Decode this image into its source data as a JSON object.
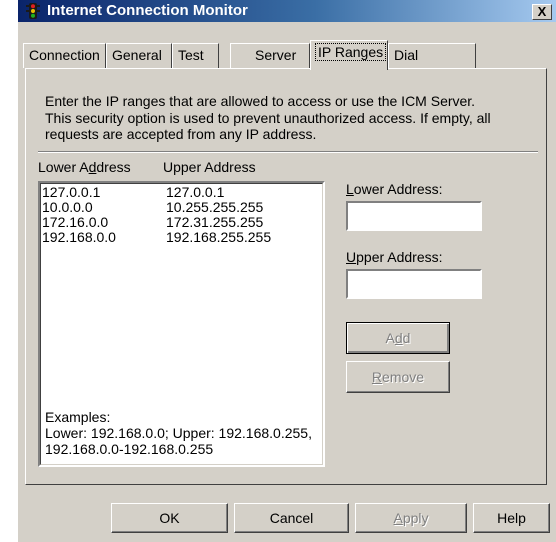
{
  "window": {
    "title": "Internet Connection Monitor",
    "close_glyph": "X"
  },
  "tabs": [
    {
      "label": "Connection"
    },
    {
      "label": "General"
    },
    {
      "label": "Test"
    },
    {
      "label": "Server"
    },
    {
      "label": "IP Ranges",
      "active": true
    },
    {
      "label": "Dial"
    }
  ],
  "panel": {
    "intro_lines": [
      "Enter the IP ranges that are allowed to access or use the ICM Server.",
      "This security option is used to prevent unauthorized access.  If empty, all",
      "requests are accepted from any IP address."
    ],
    "col_lower_pre": "Lower A",
    "col_lower_u": "d",
    "col_lower_post": "dress",
    "col_upper": "Upper Address",
    "ranges": [
      {
        "lower": "127.0.0.1",
        "upper": "127.0.0.1"
      },
      {
        "lower": "10.0.0.0",
        "upper": "10.255.255.255"
      },
      {
        "lower": "172.16.0.0",
        "upper": "172.31.255.255"
      },
      {
        "lower": "192.168.0.0",
        "upper": "192.168.255.255"
      }
    ],
    "lower_label_u": "L",
    "lower_label_rest": "ower Address:",
    "lower_value": "",
    "upper_label_u": "U",
    "upper_label_rest": "pper Address:",
    "upper_value": "",
    "add_pre": "A",
    "add_u": "d",
    "add_post": "d",
    "remove_u": "R",
    "remove_rest": "emove",
    "examples": [
      "Examples:",
      "Lower: 192.168.0.0; Upper: 192.168.0.255,",
      "192.168.0.0-192.168.0.255"
    ]
  },
  "buttons": {
    "ok": "OK",
    "cancel": "Cancel",
    "apply_u": "A",
    "apply_rest": "pply",
    "help": "Help"
  }
}
